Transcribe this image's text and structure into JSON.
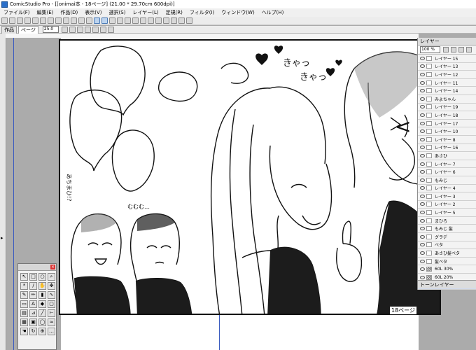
{
  "window": {
    "title": "ComicStudio Pro - [[onimai本 - 18ページ] (21.00 * 29.70cm 600dpi)]"
  },
  "menubar": {
    "items": [
      "ファイル(F)",
      "編集(E)",
      "作品(D)",
      "表示(V)",
      "選択(S)",
      "レイヤー(L)",
      "定規(R)",
      "フィルタ(I)",
      "ウィンドウ(W)",
      "ヘルプ(H)"
    ]
  },
  "tabs": [
    "作品",
    "ページ"
  ],
  "zoom": "25.0",
  "canvas": {
    "page_label": "18ページ",
    "text_ahh": "あちまひ!?",
    "text_mumu": "むむむ…",
    "text_kyakkya1": "きゃっ",
    "text_kyakkya2": "きゃっ"
  },
  "layer_panel": {
    "title": "レイヤー",
    "opacity": "100 %",
    "footer": "トーンレイヤー",
    "layers": [
      {
        "name": "レイヤー 15",
        "tone": false
      },
      {
        "name": "レイヤー 13",
        "tone": false
      },
      {
        "name": "レイヤー 12",
        "tone": false
      },
      {
        "name": "レイヤー 11",
        "tone": false
      },
      {
        "name": "レイヤー 14",
        "tone": false
      },
      {
        "name": "みよちゃん",
        "tone": false
      },
      {
        "name": "レイヤー 19",
        "tone": false
      },
      {
        "name": "レイヤー 18",
        "tone": false
      },
      {
        "name": "レイヤー 17",
        "tone": false
      },
      {
        "name": "レイヤー 10",
        "tone": false
      },
      {
        "name": "レイヤー 8",
        "tone": false
      },
      {
        "name": "レイヤー 16",
        "tone": false
      },
      {
        "name": "あさひ",
        "tone": false
      },
      {
        "name": "レイヤー 7",
        "tone": false
      },
      {
        "name": "レイヤー 6",
        "tone": false
      },
      {
        "name": "もみじ",
        "tone": false
      },
      {
        "name": "レイヤー 4",
        "tone": false
      },
      {
        "name": "レイヤー 3",
        "tone": false
      },
      {
        "name": "レイヤー 2",
        "tone": false
      },
      {
        "name": "レイヤー 5",
        "tone": false
      },
      {
        "name": "まひろ",
        "tone": false
      },
      {
        "name": "もみじ 髪",
        "tone": false
      },
      {
        "name": "グラデ",
        "tone": false
      },
      {
        "name": "ベタ",
        "tone": false
      },
      {
        "name": "あさひ髪ベタ",
        "tone": false
      },
      {
        "name": "髪ベタ",
        "tone": false
      },
      {
        "name": "60L 30%",
        "tone": true
      },
      {
        "name": "60L 20%",
        "tone": true
      },
      {
        "name": "60L 15%",
        "tone": true,
        "selected": true
      }
    ]
  }
}
